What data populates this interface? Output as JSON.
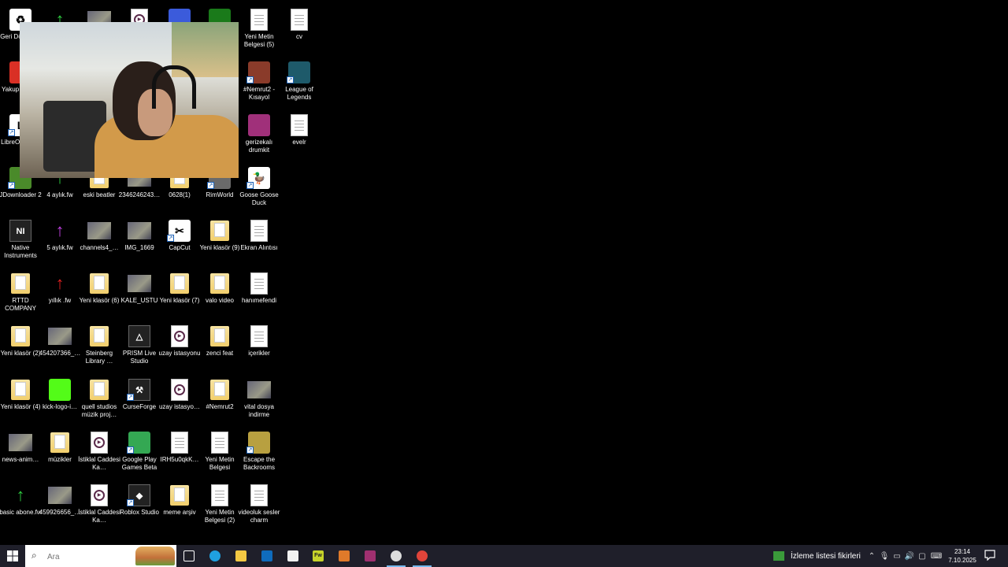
{
  "desktop_icons": [
    {
      "label": "Geri Dönüşüm",
      "kind": "white",
      "glyph": "♻"
    },
    {
      "label": "",
      "kind": "arrow",
      "color": "#2ecc40",
      "glyph": "↑"
    },
    {
      "label": "",
      "kind": "thumb"
    },
    {
      "label": "",
      "kind": "video"
    },
    {
      "label": "",
      "kind": "color",
      "color": "#3b5bdb"
    },
    {
      "label": "",
      "kind": "color",
      "color": "#1a7a1a"
    },
    {
      "label": "Yeni Metin Belgesi (5)",
      "kind": "doc"
    },
    {
      "label": "cv",
      "kind": "doc"
    },
    {
      "label": "Yakup tung…",
      "kind": "color",
      "color": "#d93025"
    },
    {
      "label": "#Nemrut2 - Kısayol",
      "kind": "color",
      "color": "#8a3b2a",
      "shortcut": true
    },
    {
      "label": "League of Legends",
      "kind": "color",
      "color": "#1e5a6a",
      "shortcut": true
    },
    {
      "label": "LibreOffice 25",
      "kind": "white",
      "glyph": "L",
      "shortcut": true
    },
    {
      "label": "gerizekalı drumkit",
      "kind": "color",
      "color": "#a0307a"
    },
    {
      "label": "evelr",
      "kind": "doc"
    },
    {
      "label": "JDownloader 2",
      "kind": "color",
      "color": "#4a8a2a",
      "shortcut": true
    },
    {
      "label": "4 aylık.fw",
      "kind": "arrow",
      "color": "#2ecc40",
      "glyph": "↑"
    },
    {
      "label": "eski beatler",
      "kind": "folder"
    },
    {
      "label": "2346246243…",
      "kind": "thumb"
    },
    {
      "label": "0628(1)",
      "kind": "folder"
    },
    {
      "label": "RimWorld",
      "kind": "color",
      "color": "#6a6a6a",
      "shortcut": true
    },
    {
      "label": "Goose Goose Duck",
      "kind": "white",
      "glyph": "🦆",
      "shortcut": true
    },
    {
      "label": "Native Instruments",
      "kind": "dark",
      "glyph": "NI"
    },
    {
      "label": "5 aylık.fw",
      "kind": "arrow",
      "color": "#c040e0",
      "glyph": "↑"
    },
    {
      "label": "channels4_…",
      "kind": "thumb"
    },
    {
      "label": "IMG_1669",
      "kind": "thumb"
    },
    {
      "label": "CapCut",
      "kind": "white",
      "glyph": "✂",
      "shortcut": true
    },
    {
      "label": "Yeni klasör (9)",
      "kind": "folder"
    },
    {
      "label": "Ekran Alıntısı",
      "kind": "doc"
    },
    {
      "label": "RTTD COMPANY",
      "kind": "folder"
    },
    {
      "label": "yıllık .fw",
      "kind": "arrow",
      "color": "#e02020",
      "glyph": "↑"
    },
    {
      "label": "Yeni klasör (6)",
      "kind": "folder"
    },
    {
      "label": "KALE_USTU",
      "kind": "thumb"
    },
    {
      "label": "Yeni klasör (7)",
      "kind": "folder"
    },
    {
      "label": "valo video",
      "kind": "folder"
    },
    {
      "label": "hanımefendi",
      "kind": "doc"
    },
    {
      "label": "Yeni klasör (2)",
      "kind": "folder"
    },
    {
      "label": "454207366_…",
      "kind": "thumb"
    },
    {
      "label": "Steinberg Library …",
      "kind": "folder"
    },
    {
      "label": "PRISM Live Studio",
      "kind": "dark",
      "glyph": "△"
    },
    {
      "label": "uzay istasyonu",
      "kind": "video"
    },
    {
      "label": "zenci feat",
      "kind": "folder"
    },
    {
      "label": "içerikler",
      "kind": "doc"
    },
    {
      "label": "Yeni klasör (4)",
      "kind": "folder"
    },
    {
      "label": "kick-logo-i…",
      "kind": "color",
      "color": "#53fc18"
    },
    {
      "label": "quell studios müzik proj…",
      "kind": "folder"
    },
    {
      "label": "CurseForge",
      "kind": "dark",
      "glyph": "⚒",
      "shortcut": true
    },
    {
      "label": "uzay istasyo…",
      "kind": "video"
    },
    {
      "label": "#Nemrut2",
      "kind": "folder"
    },
    {
      "label": "vital dosya indirme",
      "kind": "thumb"
    },
    {
      "label": "news-anim…",
      "kind": "thumb"
    },
    {
      "label": "müzikler",
      "kind": "folder"
    },
    {
      "label": "İstiklal Caddesi Ka…",
      "kind": "video"
    },
    {
      "label": "Google Play Games Beta",
      "kind": "color",
      "color": "#34a853",
      "shortcut": true
    },
    {
      "label": "IRH5u0qkK…",
      "kind": "doc"
    },
    {
      "label": "Yeni Metin Belgesi",
      "kind": "doc"
    },
    {
      "label": "Escape the Backrooms",
      "kind": "color",
      "color": "#b8a040",
      "shortcut": true
    },
    {
      "label": "basic abone.fw",
      "kind": "arrow",
      "color": "#2ecc40",
      "glyph": "↑"
    },
    {
      "label": "459926656_…",
      "kind": "thumb"
    },
    {
      "label": "İstiklal Caddesi Ka…",
      "kind": "video"
    },
    {
      "label": "Roblox Studio",
      "kind": "dark",
      "glyph": "◆",
      "shortcut": true
    },
    {
      "label": "meme arşiv",
      "kind": "folder"
    },
    {
      "label": "Yeni Metin Belgesi (2)",
      "kind": "doc"
    },
    {
      "label": "videoluk sesler charm",
      "kind": "doc"
    }
  ],
  "taskbar": {
    "search_placeholder": "Ara",
    "pinned": [
      {
        "name": "task-view",
        "glyph": "⧉",
        "color": "#ffffff"
      },
      {
        "name": "edge",
        "glyph": "",
        "color": "#1fa0e0"
      },
      {
        "name": "file-explorer",
        "glyph": "",
        "color": "#f3c843"
      },
      {
        "name": "outlook",
        "glyph": "",
        "color": "#0f6cbd"
      },
      {
        "name": "store",
        "glyph": "",
        "color": "#f2f2f2"
      },
      {
        "name": "fireworks",
        "glyph": "Fw",
        "color": "#c8d42a"
      },
      {
        "name": "shield-app",
        "glyph": "",
        "color": "#e07a2a"
      },
      {
        "name": "winrar",
        "glyph": "",
        "color": "#a03070"
      },
      {
        "name": "obs",
        "glyph": "",
        "color": "#dddddd"
      },
      {
        "name": "chrome",
        "glyph": "",
        "color": "#e0443a"
      }
    ],
    "watchlist_label": "İzleme listesi fikirleri",
    "time": "23:14",
    "date": "7.10.2025"
  }
}
